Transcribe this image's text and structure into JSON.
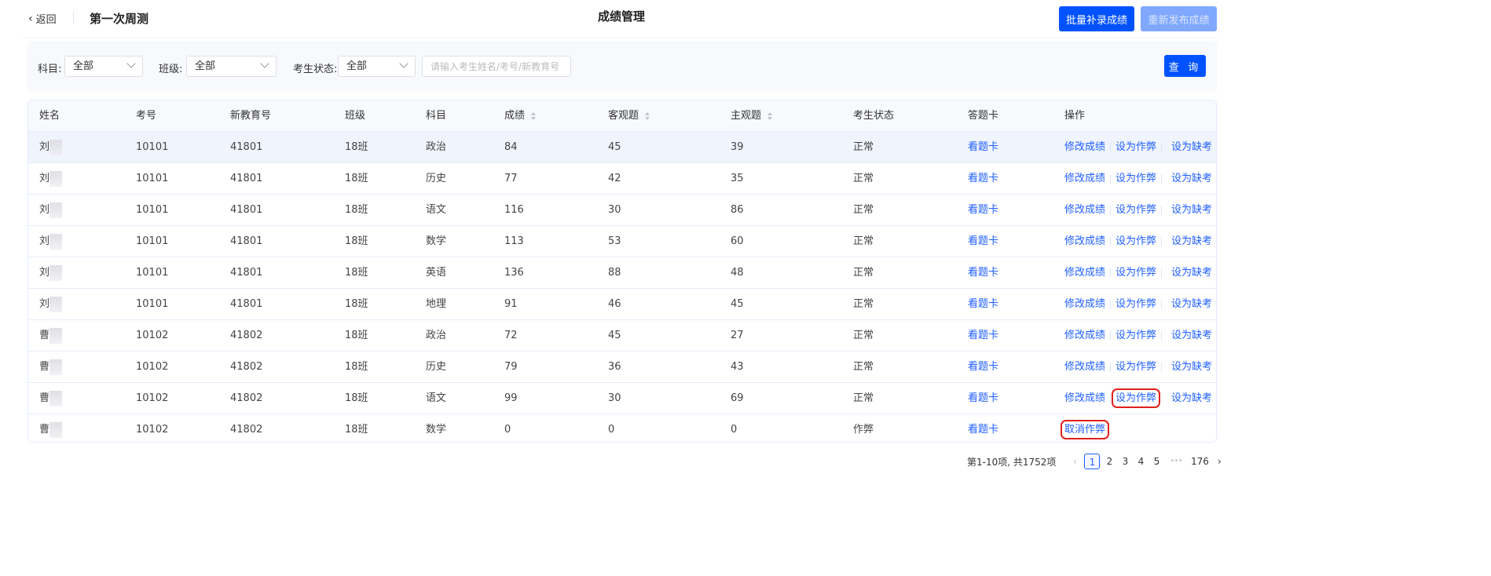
{
  "header": {
    "back": "返回",
    "exam_title": "第一次周测",
    "page_title": "成绩管理",
    "batch_btn": "批量补录成绩",
    "republish_btn": "重新发布成绩"
  },
  "filters": {
    "subject_label": "科目:",
    "subject_value": "全部",
    "class_label": "班级:",
    "class_value": "全部",
    "status_label": "考生状态:",
    "status_value": "全部",
    "search_placeholder": "请输入考生姓名/考号/新教育号",
    "query_btn": "查 询"
  },
  "columns": [
    "姓名",
    "考号",
    "新教育号",
    "班级",
    "科目",
    "成绩",
    "客观题",
    "主观题",
    "考生状态",
    "答题卡",
    "操作"
  ],
  "actions": {
    "edit": "修改成绩",
    "cheat": "设为作弊",
    "absent": "设为缺考",
    "cancel_cheat": "取消作弊",
    "card": "看题卡"
  },
  "rows": [
    {
      "name": "刘",
      "id": "10101",
      "edu": "41801",
      "cls": "18班",
      "subj": "政治",
      "score": "84",
      "obj": "45",
      "subj_score": "39",
      "status": "正常"
    },
    {
      "name": "刘",
      "id": "10101",
      "edu": "41801",
      "cls": "18班",
      "subj": "历史",
      "score": "77",
      "obj": "42",
      "subj_score": "35",
      "status": "正常"
    },
    {
      "name": "刘",
      "id": "10101",
      "edu": "41801",
      "cls": "18班",
      "subj": "语文",
      "score": "116",
      "obj": "30",
      "subj_score": "86",
      "status": "正常"
    },
    {
      "name": "刘",
      "id": "10101",
      "edu": "41801",
      "cls": "18班",
      "subj": "数学",
      "score": "113",
      "obj": "53",
      "subj_score": "60",
      "status": "正常"
    },
    {
      "name": "刘",
      "id": "10101",
      "edu": "41801",
      "cls": "18班",
      "subj": "英语",
      "score": "136",
      "obj": "88",
      "subj_score": "48",
      "status": "正常"
    },
    {
      "name": "刘",
      "id": "10101",
      "edu": "41801",
      "cls": "18班",
      "subj": "地理",
      "score": "91",
      "obj": "46",
      "subj_score": "45",
      "status": "正常"
    },
    {
      "name": "曹",
      "id": "10102",
      "edu": "41802",
      "cls": "18班",
      "subj": "政治",
      "score": "72",
      "obj": "45",
      "subj_score": "27",
      "status": "正常"
    },
    {
      "name": "曹",
      "id": "10102",
      "edu": "41802",
      "cls": "18班",
      "subj": "历史",
      "score": "79",
      "obj": "36",
      "subj_score": "43",
      "status": "正常"
    },
    {
      "name": "曹",
      "id": "10102",
      "edu": "41802",
      "cls": "18班",
      "subj": "语文",
      "score": "99",
      "obj": "30",
      "subj_score": "69",
      "status": "正常"
    },
    {
      "name": "曹",
      "id": "10102",
      "edu": "41802",
      "cls": "18班",
      "subj": "数学",
      "score": "0",
      "obj": "0",
      "subj_score": "0",
      "status": "作弊"
    }
  ],
  "pagination": {
    "summary": "第1-10项, 共1752项",
    "pages": [
      "1",
      "2",
      "3",
      "4",
      "5"
    ],
    "ellipsis": "•••",
    "last": "176",
    "current": "1"
  }
}
